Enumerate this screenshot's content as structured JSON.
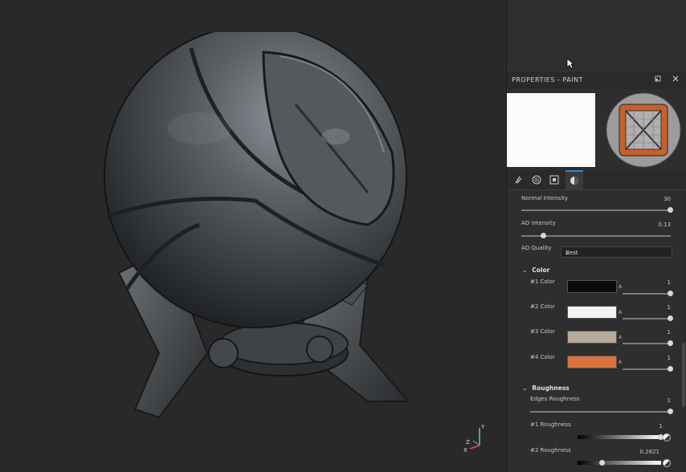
{
  "viewport": {
    "axis_labels": {
      "y": "Y",
      "x": "X",
      "z": "Z"
    }
  },
  "panel": {
    "title": "PROPERTIES - PAINT",
    "header_icons": [
      "float-window-icon",
      "close-icon"
    ],
    "tabs": [
      {
        "icon": "brush-tool-icon"
      },
      {
        "icon": "alpha-icon"
      },
      {
        "icon": "stencil-icon"
      },
      {
        "icon": "material-icon",
        "active": true
      }
    ],
    "properties": {
      "normal_intensity": {
        "label": "Normal Intensity",
        "value": "30",
        "fraction": 1.0
      },
      "ao_intensity": {
        "label": "AO intensity",
        "value": "0.13",
        "fraction": 0.13
      },
      "ao_quality": {
        "label": "AO Quality",
        "selected": "Best"
      }
    },
    "color_section": {
      "title": "Color",
      "alpha_label": "A",
      "items": [
        {
          "label": "#1 Color",
          "color": "#0a0a0a",
          "alpha": "1"
        },
        {
          "label": "#2 Color",
          "color": "#f2f2f2",
          "alpha": "1"
        },
        {
          "label": "#3 Color",
          "color": "#b5aa9b",
          "alpha": "1"
        },
        {
          "label": "#4 Color",
          "color": "#d9733a",
          "alpha": "1"
        }
      ]
    },
    "roughness_section": {
      "title": "Roughness",
      "edges": {
        "label": "Edges Roughness",
        "value": "1"
      },
      "r1": {
        "label": "#1 Roughness",
        "value": "1",
        "fraction": 1.0
      },
      "r2": {
        "label": "#2 Roughness",
        "value": "0.2821",
        "fraction": 0.28
      }
    }
  }
}
